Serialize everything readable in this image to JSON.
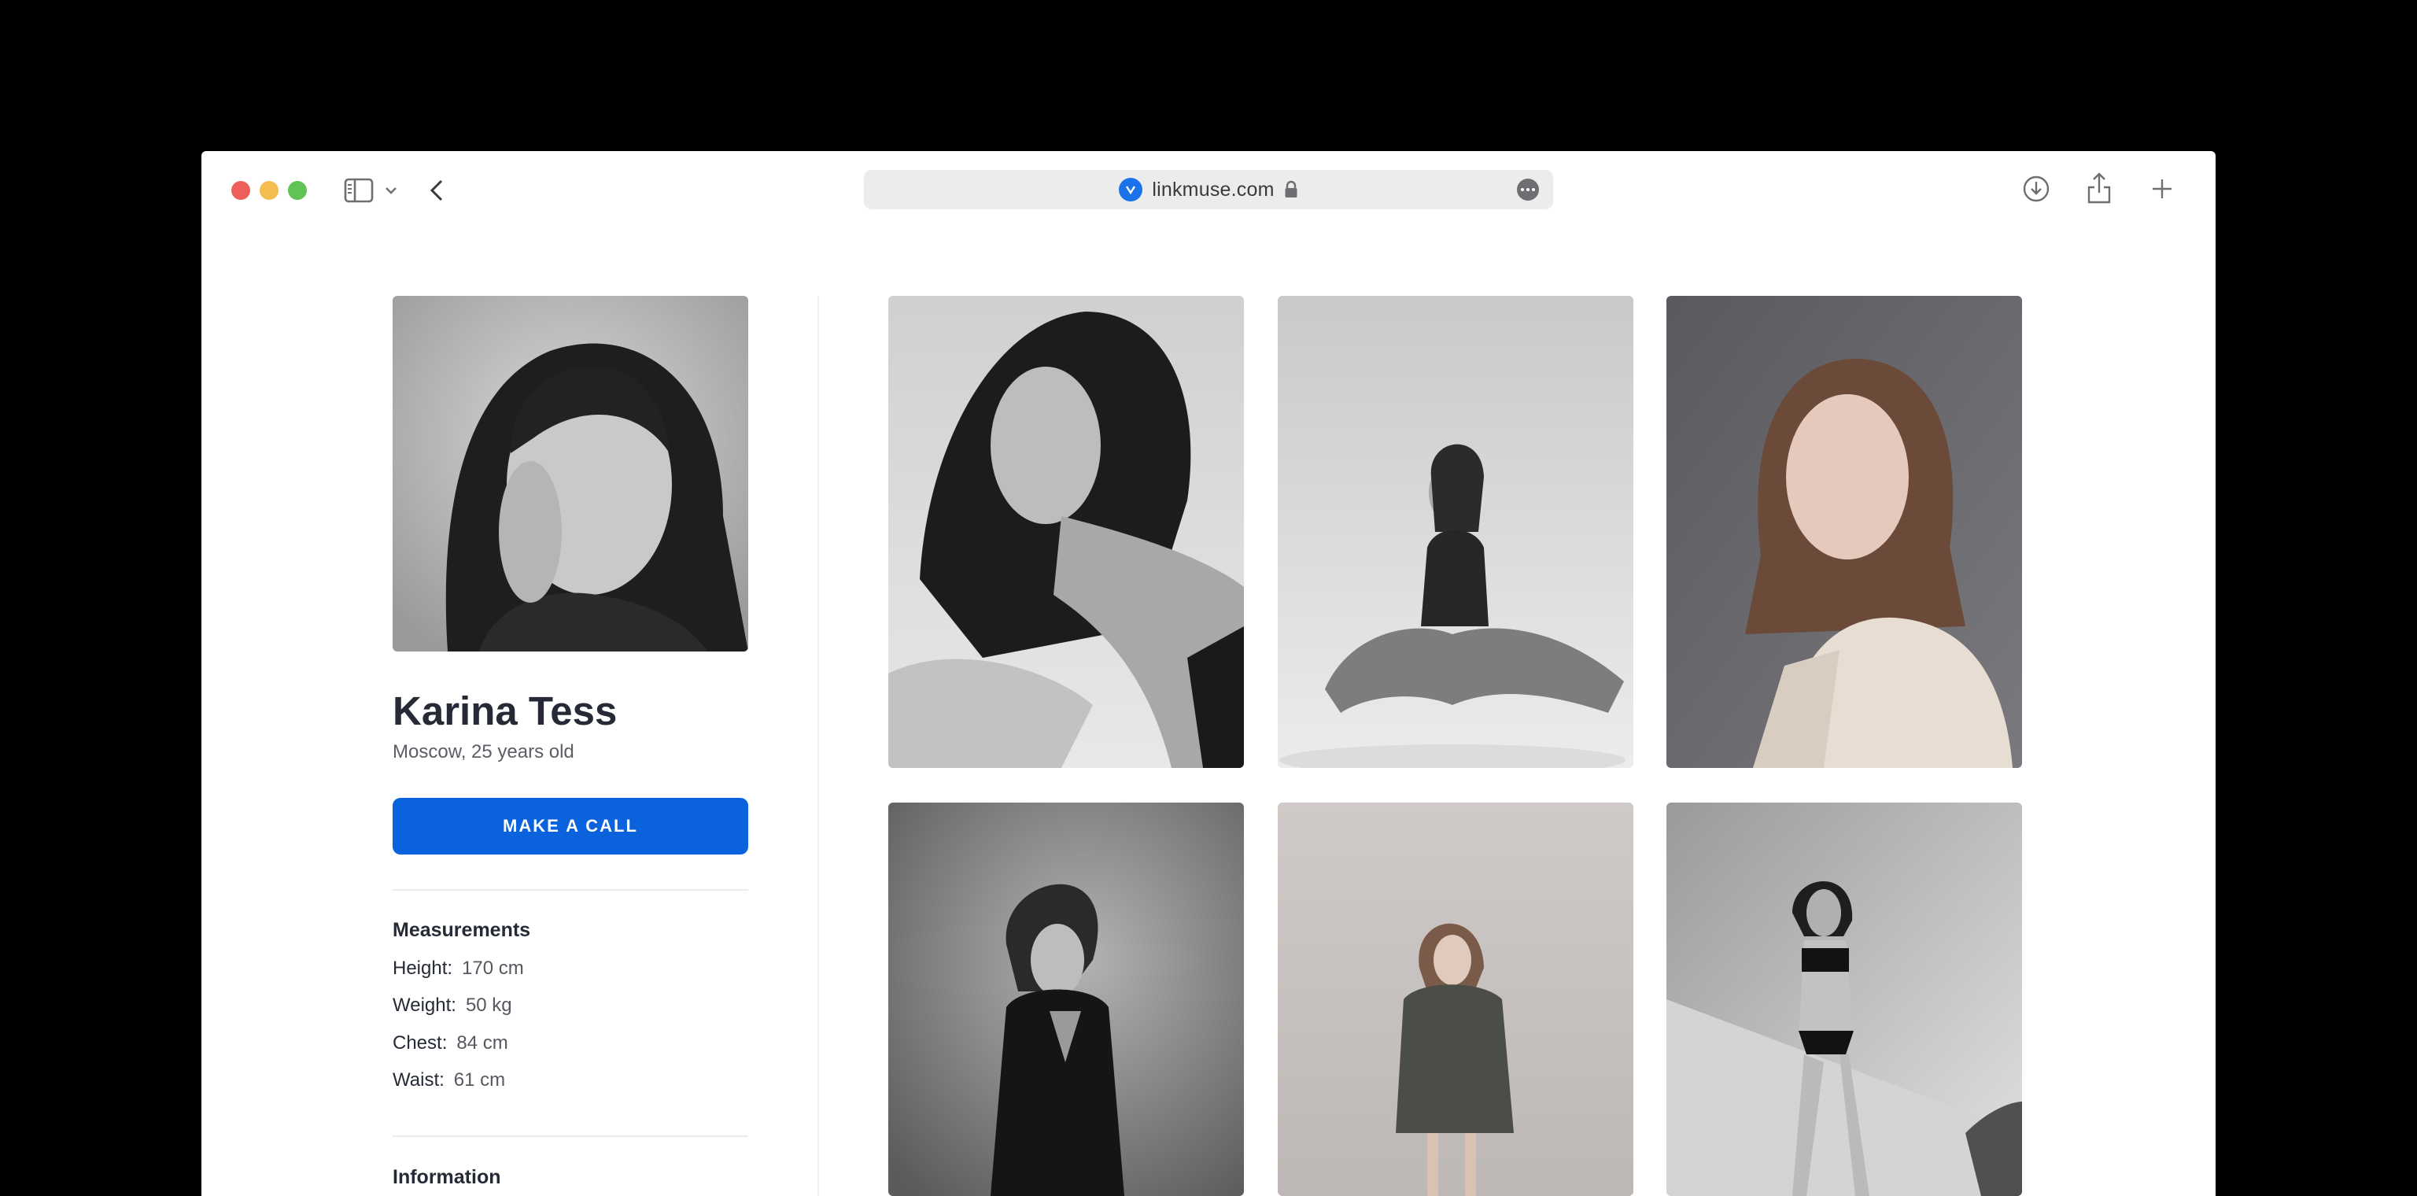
{
  "browser": {
    "url": "linkmuse.com"
  },
  "profile": {
    "name": "Karina Tess",
    "subtitle": "Moscow, 25 years old",
    "call_label": "MAKE A CALL"
  },
  "measurements": {
    "title": "Measurements",
    "rows": [
      {
        "label": "Height:",
        "value": "170 cm"
      },
      {
        "label": "Weight:",
        "value": "50 kg"
      },
      {
        "label": "Chest:",
        "value": "84 cm"
      },
      {
        "label": "Waist:",
        "value": "61 cm"
      }
    ]
  },
  "information": {
    "title": "Information"
  },
  "colors": {
    "accent": "#0a63dc",
    "favicon": "#1a73e8"
  }
}
